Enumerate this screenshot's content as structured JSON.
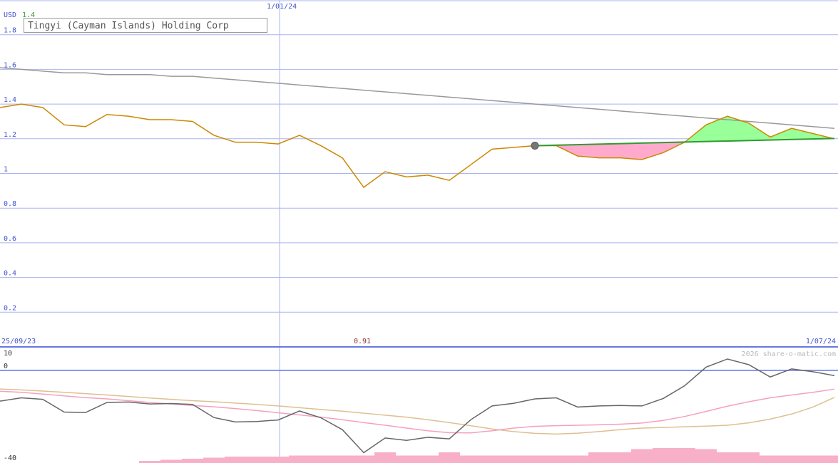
{
  "chart_data": [
    {
      "type": "line",
      "title": "Tingyi (Cayman Islands) Holding Corp",
      "currency_label": "USD",
      "last_price_label": "1.4",
      "ylim": [
        0,
        2
      ],
      "y_ticks": [
        {
          "value": 0.2,
          "label": "0.2"
        },
        {
          "value": 0.4,
          "label": "0.4"
        },
        {
          "value": 0.6,
          "label": "0.6"
        },
        {
          "value": 0.8,
          "label": "0.8"
        },
        {
          "value": 1.0,
          "label": "1"
        },
        {
          "value": 1.2,
          "label": "1.2"
        },
        {
          "value": 1.4,
          "label": "1.4"
        },
        {
          "value": 1.6,
          "label": "1.6"
        },
        {
          "value": 1.8,
          "label": "1.8"
        }
      ],
      "x_labels": {
        "start": "25/09/23",
        "mid": "1/01/24",
        "end": "1/07/24"
      },
      "low_label": "0.91",
      "grid": true,
      "series": [
        {
          "role": "price",
          "color": "#cc8800",
          "values": [
            1.38,
            1.4,
            1.38,
            1.28,
            1.27,
            1.34,
            1.33,
            1.31,
            1.31,
            1.3,
            1.22,
            1.18,
            1.18,
            1.17,
            1.22,
            1.16,
            1.09,
            0.92,
            1.01,
            0.98,
            0.99,
            0.96,
            1.05,
            1.14,
            1.15,
            1.16,
            1.16,
            1.1,
            1.09,
            1.09,
            1.08,
            1.12,
            1.18,
            1.28,
            1.33,
            1.29,
            1.21,
            1.26,
            1.23,
            1.2
          ]
        },
        {
          "role": "long-average",
          "color": "#999999",
          "values": [
            1.61,
            1.6,
            1.59,
            1.58,
            1.58,
            1.57,
            1.57,
            1.57,
            1.56,
            1.56,
            1.55,
            1.54,
            1.53,
            1.52,
            1.51,
            1.5,
            1.49,
            1.48,
            1.47,
            1.46,
            1.45,
            1.44,
            1.43,
            1.42,
            1.41,
            1.4,
            1.39,
            1.38,
            1.37,
            1.36,
            1.35,
            1.34,
            1.33,
            1.32,
            1.31,
            1.3,
            1.29,
            1.28,
            1.27,
            1.26
          ]
        },
        {
          "role": "trend",
          "color": "#339933",
          "start_index": 25,
          "values": [
            1.16,
            1.202
          ]
        }
      ],
      "marker": {
        "index": 25,
        "value": 1.16,
        "color": "#777777"
      },
      "fill_above_color": "#99ff99",
      "fill_below_color": "#ffaacc"
    },
    {
      "type": "line",
      "ylim": [
        -40,
        10
      ],
      "y_ticks": [
        {
          "value": 10,
          "label": "10"
        },
        {
          "value": 0,
          "label": "0"
        },
        {
          "value": -40,
          "label": "-40"
        }
      ],
      "watermark": "2026 share-o-matic.com",
      "series": [
        {
          "role": "oscillator",
          "color": "#666666",
          "values": [
            -14.0,
            -12.5,
            -13.2,
            -19.0,
            -19.2,
            -14.6,
            -14.4,
            -15.3,
            -15.1,
            -15.5,
            -21.5,
            -23.5,
            -23.3,
            -22.6,
            -18.5,
            -21.6,
            -27.0,
            -37.5,
            -30.8,
            -31.9,
            -30.5,
            -31.2,
            -22.5,
            -16.2,
            -15.0,
            -13.0,
            -12.5,
            -16.7,
            -16.2,
            -16.0,
            -16.2,
            -12.8,
            -7.0,
            1.5,
            5.2,
            2.6,
            -3.0,
            0.7,
            -0.6,
            -2.4
          ]
        },
        {
          "role": "fast-average",
          "color": "#f5a0bf",
          "values": [
            -9.5,
            -10.0,
            -10.8,
            -11.6,
            -12.4,
            -13.0,
            -13.8,
            -14.6,
            -15.3,
            -16.0,
            -16.6,
            -17.4,
            -18.3,
            -19.3,
            -20.3,
            -21.3,
            -22.5,
            -23.8,
            -25.0,
            -26.3,
            -27.5,
            -28.4,
            -28.5,
            -27.5,
            -26.3,
            -25.5,
            -25.2,
            -25.0,
            -24.8,
            -24.5,
            -24.0,
            -22.8,
            -21.0,
            -18.7,
            -16.3,
            -14.3,
            -12.5,
            -11.2,
            -10.0,
            -8.5
          ]
        },
        {
          "role": "slow-average",
          "color": "#ddc090",
          "values": [
            -8.5,
            -8.9,
            -9.4,
            -10.0,
            -10.6,
            -11.2,
            -11.9,
            -12.6,
            -13.2,
            -13.8,
            -14.3,
            -14.9,
            -15.5,
            -16.2,
            -17.0,
            -17.8,
            -18.6,
            -19.5,
            -20.4,
            -21.3,
            -22.5,
            -23.8,
            -25.2,
            -26.7,
            -27.9,
            -28.7,
            -29.0,
            -28.6,
            -27.9,
            -27.0,
            -26.3,
            -26.0,
            -25.7,
            -25.4,
            -25.0,
            -23.9,
            -22.2,
            -19.9,
            -16.7,
            -12.3
          ]
        },
        {
          "role": "volume",
          "color": "#f7b0c8",
          "values": [
            0,
            0,
            0,
            0,
            0,
            0,
            0,
            1,
            1.5,
            2,
            2.5,
            3,
            3,
            3,
            3.5,
            3.5,
            3.5,
            3.5,
            5,
            3.5,
            3.5,
            5,
            3.5,
            3.5,
            3.5,
            3.5,
            3.5,
            3.5,
            5,
            5,
            6.5,
            7,
            7,
            6.5,
            5,
            5,
            3.5,
            3.5,
            3.5,
            3.5
          ]
        }
      ]
    }
  ]
}
